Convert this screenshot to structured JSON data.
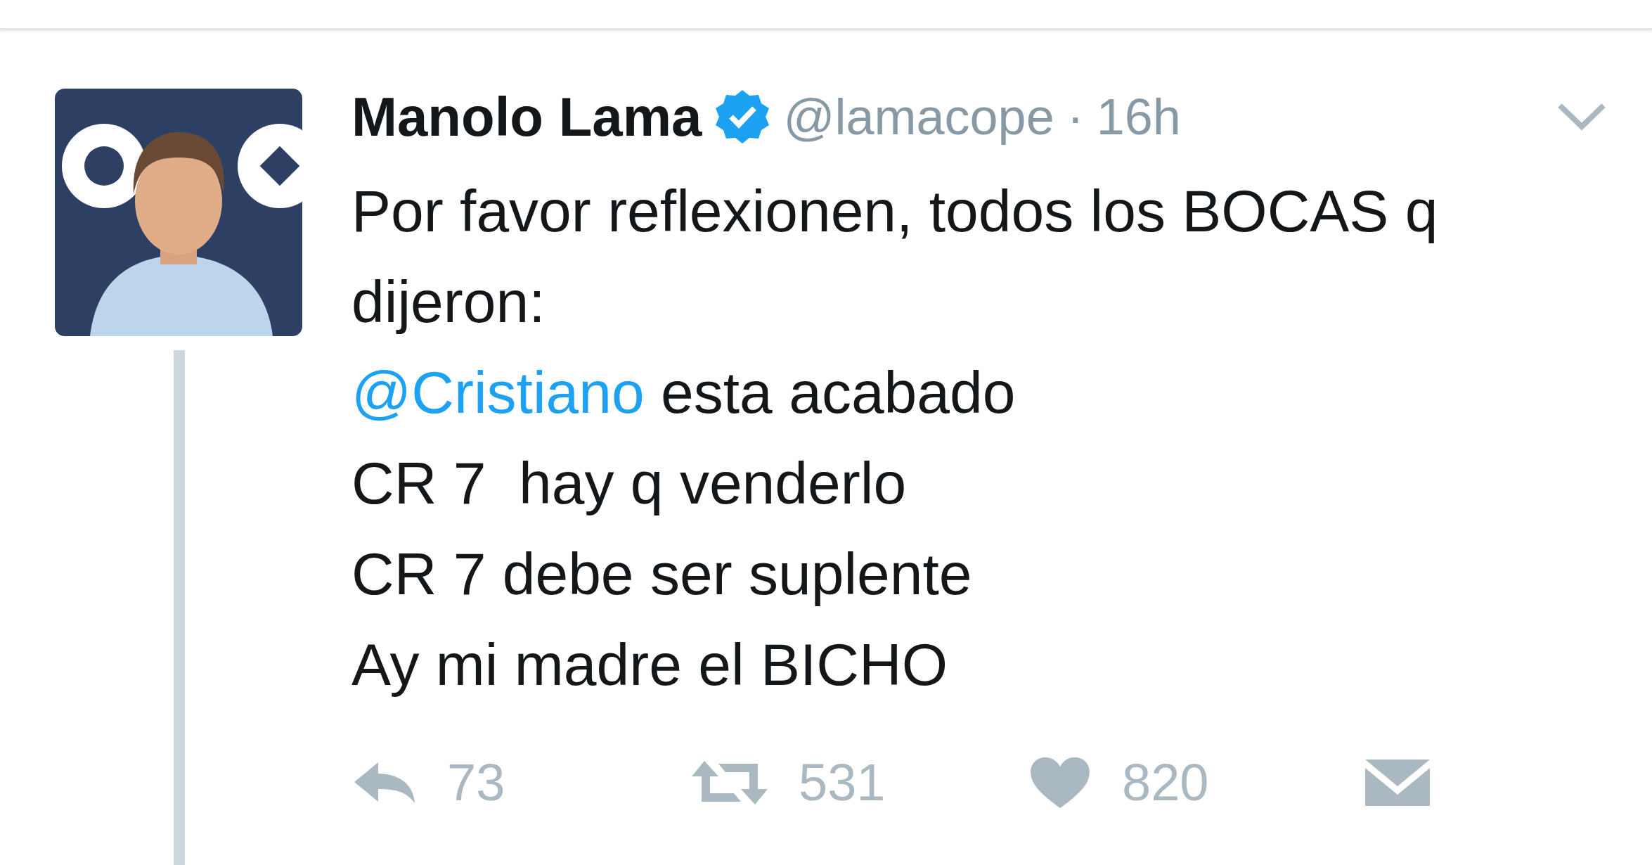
{
  "tweet": {
    "avatar": {
      "kind": "picture"
    },
    "name": "Manolo Lama",
    "verified": true,
    "handle": "@lamacope",
    "separator": "·",
    "time": "16h",
    "text": [
      [
        {
          "kind": "text",
          "text": "Por favor reflexionen, todos los BOCAS q dijeron:"
        }
      ],
      [
        {
          "kind": "mention",
          "text": "@Cristiano"
        },
        {
          "kind": "text",
          "text": " esta acabado"
        }
      ],
      [
        {
          "kind": "text",
          "text": "CR 7  hay q venderlo"
        }
      ],
      [
        {
          "kind": "text",
          "text": "CR 7 debe ser suplente"
        }
      ],
      [
        {
          "kind": "text",
          "text": "Ay mi madre el BICHO"
        }
      ]
    ],
    "actions": [
      {
        "kind": "reply",
        "count": "73"
      },
      {
        "kind": "retweet",
        "count": "531"
      },
      {
        "kind": "like",
        "count": "820"
      },
      {
        "kind": "message"
      }
    ]
  }
}
